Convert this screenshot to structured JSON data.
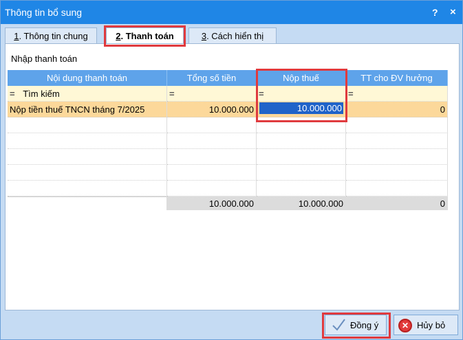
{
  "window": {
    "title": "Thông tin bổ sung",
    "help": "?",
    "close": "×"
  },
  "tabs": [
    {
      "num": "1",
      "label": ". Thông tin chung"
    },
    {
      "num": "2",
      "label": ". Thanh toán"
    },
    {
      "num": "3",
      "label": ". Cách hiển thị"
    }
  ],
  "section_label": "Nhập thanh toán",
  "grid": {
    "headers": [
      "Nội dung thanh toán",
      "Tổng số tiền",
      "Nộp thuế",
      "TT cho ĐV hưởng"
    ],
    "filter": {
      "eq": "=",
      "search_text": "Tìm kiếm"
    },
    "row": {
      "content": "Nộp tiền thuế TNCN tháng 7/2025",
      "total": "10.000.000",
      "tax": "10.000.000",
      "beneficiary": "0"
    },
    "footer": {
      "total": "10.000.000",
      "tax": "10.000.000",
      "beneficiary": "0"
    }
  },
  "buttons": {
    "ok": "Đồng ý",
    "cancel": "Hủy bỏ"
  },
  "colors": {
    "titlebar": "#1f86e6",
    "header": "#5ea3ea",
    "highlight": "#e03a3e",
    "row": "#fcd89a",
    "filter": "#fff8d6"
  }
}
